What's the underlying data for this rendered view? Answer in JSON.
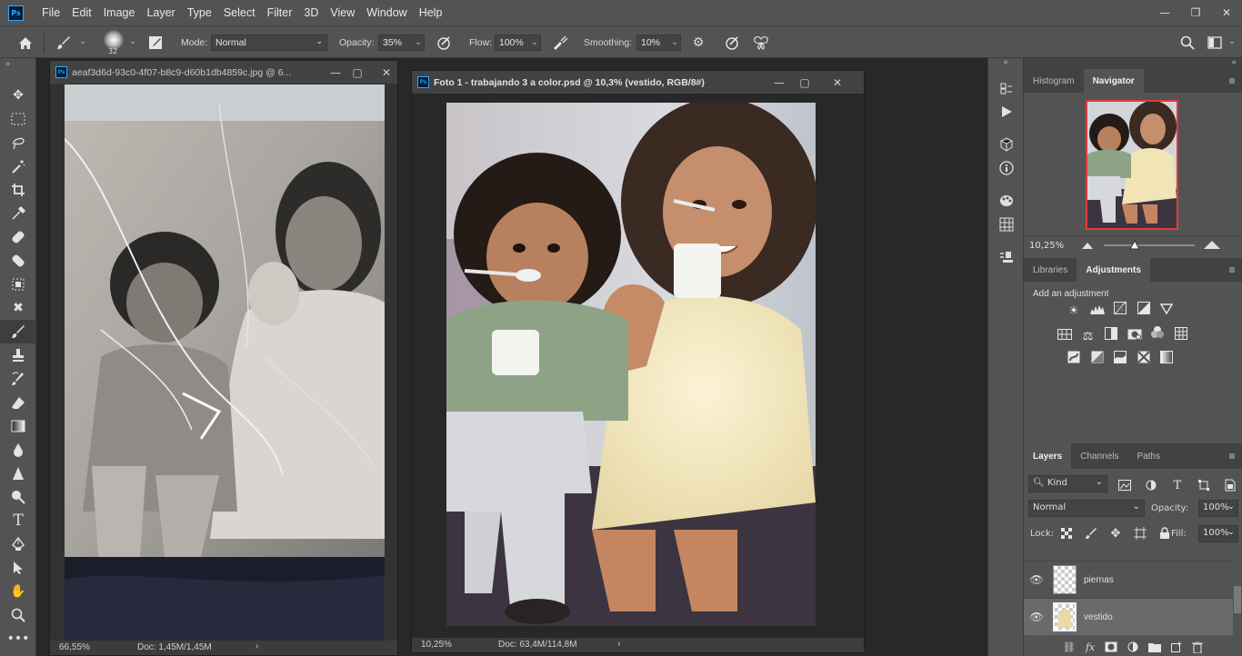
{
  "app": {
    "logo": "Ps"
  },
  "menu": [
    "File",
    "Edit",
    "Image",
    "Layer",
    "Type",
    "Select",
    "Filter",
    "3D",
    "View",
    "Window",
    "Help"
  ],
  "options": {
    "brush_size": "32",
    "mode_label": "Mode:",
    "mode_value": "Normal",
    "opacity_label": "Opacity:",
    "opacity_value": "35%",
    "flow_label": "Flow:",
    "flow_value": "100%",
    "smoothing_label": "Smoothing:",
    "smoothing_value": "10%"
  },
  "doc1": {
    "title": "aeaf3d6d-93c0-4f07-b8c9-d60b1db4859c.jpg @ 6...",
    "zoom": "66,55%",
    "doc_info": "Doc: 1,45M/1,45M"
  },
  "doc2": {
    "title": "Foto 1 - trabajando 3 a color.psd @ 10,3% (vestido, RGB/8#)",
    "zoom": "10,25%",
    "doc_info": "Doc: 63,4M/114,8M"
  },
  "navigator": {
    "tabs": [
      "Histogram",
      "Navigator"
    ],
    "zoom": "10,25%"
  },
  "adjustments": {
    "tabs": [
      "Libraries",
      "Adjustments"
    ],
    "hint": "Add an adjustment"
  },
  "layers_panel": {
    "tabs": [
      "Layers",
      "Channels",
      "Paths"
    ],
    "kind_label": "Kind",
    "blend_mode": "Normal",
    "opacity_label": "Opacity:",
    "opacity_value": "100%",
    "lock_label": "Lock:",
    "fill_label": "Fill:",
    "fill_value": "100%",
    "layers": [
      {
        "name": "piernas"
      },
      {
        "name": "vestido"
      }
    ]
  },
  "colors": {
    "accent": "#31a8ff",
    "navigator_frame": "#e03a3a"
  }
}
